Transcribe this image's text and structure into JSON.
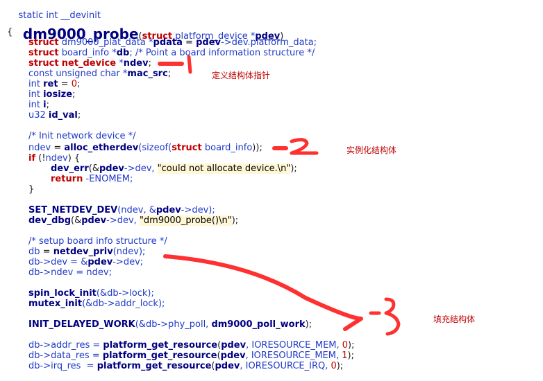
{
  "header": {
    "signature": "static int __devinit",
    "func_name": "dm9000_probe",
    "open_paren": "(",
    "param_struct_kw": "struct",
    "param_type": "platform_device",
    "param_star": "*",
    "param_name": "pdev",
    "close_paren": ")"
  },
  "code": {
    "brace_open": "{",
    "l1_kw": "struct",
    "l1_type": "dm9000_plat_data",
    "l1_star": " *",
    "l1_name": "pdata",
    "l1_eq": " = ",
    "l1_pdev": "pdev",
    "l1_rest": "->dev.platform_data;",
    "l2_kw": "struct",
    "l2_type": "board_info",
    "l2_star": " *",
    "l2_name": "db",
    "l2_comment": "; /* Point a board information structure */",
    "l3_kw": "struct",
    "l3_type": "net_device",
    "l3_star": " *",
    "l3_name": "ndev",
    "l3_semi": ";",
    "l4_prefix": "const unsigned char *",
    "l4_name": "mac_src",
    "l4_semi": ";",
    "l5_type": "int",
    "l5_name": "ret",
    "l5_eq": " = ",
    "l5_num": "0",
    "l5_semi": ";",
    "l6_type": "int",
    "l6_name": "iosize",
    "l6_semi": ";",
    "l7_type": "int",
    "l7_name": "i",
    "l7_semi": ";",
    "l8_type": "u32",
    "l8_name": "id_val",
    "l8_semi": ";",
    "c1": "/* Init network device */",
    "l9_var": "ndev",
    "l9_eq": " = ",
    "l9_fn": "alloc_etherdev",
    "l9_open": "(sizeof(",
    "l9_kw": "struct",
    "l9_type": "board_info",
    "l9_close": "));",
    "l10_kw": "if",
    "l10_rest": " (!",
    "l10_var": "ndev",
    "l10_end": ") {",
    "l11_fn": "dev_err",
    "l11_open": "(&",
    "l11_pdev": "pdev",
    "l11_mid": "->dev, ",
    "l11_str": "\"could not allocate device.\\n\"",
    "l11_end": ");",
    "l12_kw": "return",
    "l12_rest": " -ENOMEM;",
    "brace_inner_close": "}",
    "l13_fn": "SET_NETDEV_DEV",
    "l13_open": "(ndev, &",
    "l13_pdev": "pdev",
    "l13_end": "->dev);",
    "l14_fn": "dev_dbg",
    "l14_open": "(&",
    "l14_pdev": "pdev",
    "l14_mid": "->dev, ",
    "l14_str": "\"dm9000_probe()\\n\"",
    "l14_end": ");",
    "c2": "/* setup board info structure */",
    "l15_var": "db",
    "l15_eq": " = ",
    "l15_fn": "netdev_priv",
    "l15_rest": "(ndev);",
    "l16_pre": "db->dev = &",
    "l16_pdev": "pdev",
    "l16_rest": "->dev;",
    "l17": "db->ndev = ndev;",
    "l18_fn": "spin_lock_init",
    "l18_rest": "(&db->lock);",
    "l19_fn": "mutex_init",
    "l19_rest": "(&db->addr_lock);",
    "l20_fn": "INIT_DELAYED_WORK",
    "l20_mid": "(&db->phy_poll, ",
    "l20_fn2": "dm9000_poll_work",
    "l20_end": ");",
    "l21_pre": "db->addr_res = ",
    "l21_fn": "platform_get_resource",
    "l21_open": "(",
    "l21_pdev": "pdev",
    "l21_mid": ", IORESOURCE_MEM, ",
    "l21_num": "0",
    "l21_end": ");",
    "l22_pre": "db->data_res = ",
    "l22_fn": "platform_get_resource",
    "l22_open": "(",
    "l22_pdev": "pdev",
    "l22_mid": ", IORESOURCE_MEM, ",
    "l22_num": "1",
    "l22_end": ");",
    "l23_pre": "db->irq_res  = ",
    "l23_fn": "platform_get_resource",
    "l23_open": "(",
    "l23_pdev": "pdev",
    "l23_mid": ", IORESOURCE_IRQ, ",
    "l23_num": "0",
    "l23_end": ");"
  },
  "annotations": {
    "note1": "定义结构体指针",
    "note2": "实例化结构体",
    "note3": "填充结构体"
  },
  "colors": {
    "keyword": "#c00000",
    "identifier": "#000080",
    "type": "#1f3ac7",
    "annotation": "#c00000",
    "marker_red": "#ff3030"
  }
}
